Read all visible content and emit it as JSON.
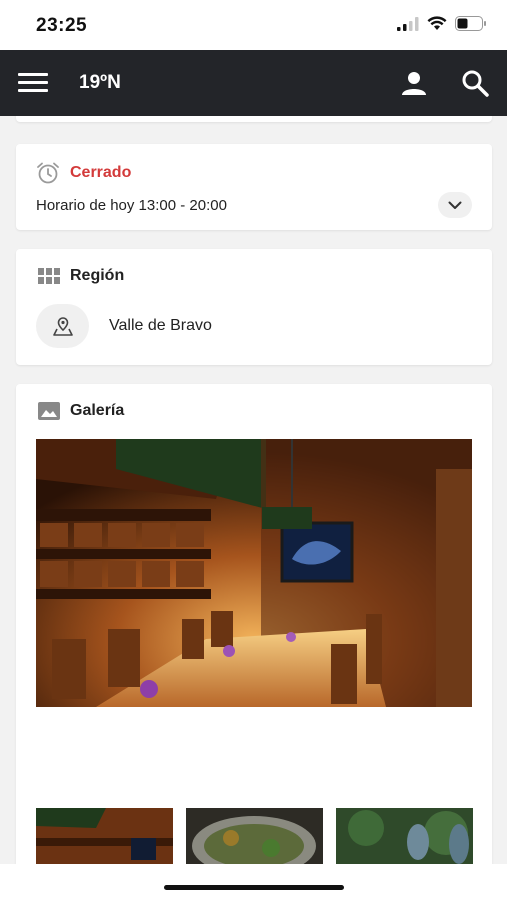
{
  "status_bar": {
    "time": "23:25"
  },
  "app_bar": {
    "title": "19ºN"
  },
  "hours": {
    "status": "Cerrado",
    "text": "Horario de hoy 13:00 - 20:00",
    "status_color": "#d33a3a"
  },
  "region": {
    "title": "Región",
    "name": "Valle de Bravo"
  },
  "gallery": {
    "title": "Galería"
  },
  "colors": {
    "app_bar": "#232529",
    "background": "#f2f2f2",
    "accent": "#d33a3a"
  }
}
